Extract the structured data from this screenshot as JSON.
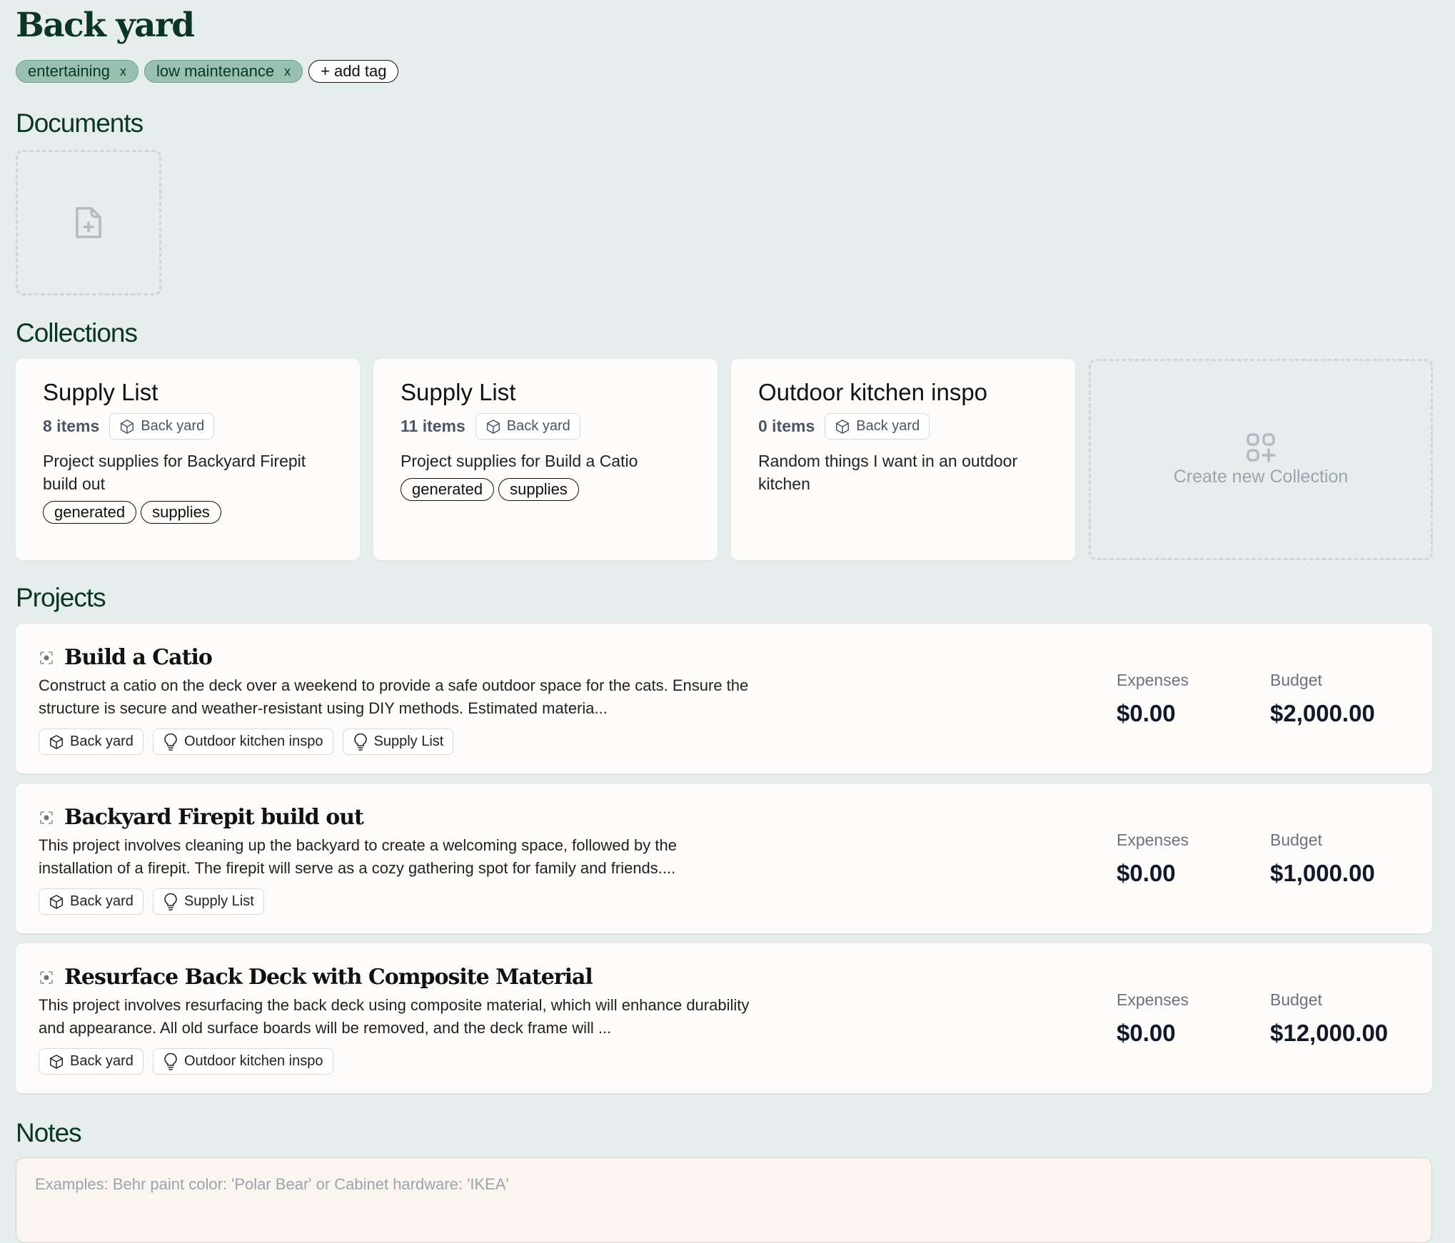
{
  "page": {
    "title": "Back yard",
    "tags": [
      {
        "label": "entertaining",
        "remove": "x"
      },
      {
        "label": "low maintenance",
        "remove": "x"
      }
    ],
    "add_tag_label": "+ add tag"
  },
  "sections": {
    "documents": "Documents",
    "collections": "Collections",
    "projects": "Projects",
    "notes": "Notes"
  },
  "documents": {
    "add_icon": "file-plus-icon"
  },
  "collections": [
    {
      "name": "Supply List",
      "count": "8 items",
      "space": "Back yard",
      "description": "Project supplies for Backyard Firepit build out",
      "tags": [
        "generated",
        "supplies"
      ]
    },
    {
      "name": "Supply List",
      "count": "11 items",
      "space": "Back yard",
      "description": "Project supplies for Build a Catio",
      "tags": [
        "generated",
        "supplies"
      ]
    },
    {
      "name": "Outdoor kitchen inspo",
      "count": "0 items",
      "space": "Back yard",
      "description": "Random things I want in an outdoor kitchen",
      "tags": []
    }
  ],
  "create_collection": {
    "label": "Create new Collection",
    "icon": "grid-plus-icon"
  },
  "projects": [
    {
      "name": "Build a Catio",
      "description": "Construct a catio on the deck over a weekend to provide a safe outdoor space for the cats. Ensure the structure is secure and weather-resistant using DIY methods. Estimated materia...",
      "chips": [
        {
          "icon": "cube-icon",
          "label": "Back yard"
        },
        {
          "icon": "lightbulb-icon",
          "label": "Outdoor kitchen inspo"
        },
        {
          "icon": "lightbulb-icon",
          "label": "Supply List"
        }
      ],
      "expenses_label": "Expenses",
      "expenses": "$0.00",
      "budget_label": "Budget",
      "budget": "$2,000.00"
    },
    {
      "name": "Backyard Firepit build out",
      "description": "This project involves cleaning up the backyard to create a welcoming space, followed by the installation of a firepit. The firepit will serve as a cozy gathering spot for family and friends....",
      "chips": [
        {
          "icon": "cube-icon",
          "label": "Back yard"
        },
        {
          "icon": "lightbulb-icon",
          "label": "Supply List"
        }
      ],
      "expenses_label": "Expenses",
      "expenses": "$0.00",
      "budget_label": "Budget",
      "budget": "$1,000.00"
    },
    {
      "name": "Resurface Back Deck with Composite Material",
      "description": "This project involves resurfacing the back deck using composite material, which will enhance durability and appearance. All old surface boards will be removed, and the deck frame will ...",
      "chips": [
        {
          "icon": "cube-icon",
          "label": "Back yard"
        },
        {
          "icon": "lightbulb-icon",
          "label": "Outdoor kitchen inspo"
        }
      ],
      "expenses_label": "Expenses",
      "expenses": "$0.00",
      "budget_label": "Budget",
      "budget": "$12,000.00"
    }
  ],
  "notes": {
    "placeholder": "Examples: Behr paint color: 'Polar Bear' or Cabinet hardware: 'IKEA'",
    "value": ""
  },
  "colors": {
    "background": "#e5eeed",
    "heading": "#0c3526",
    "tag_fill": "#99c1b2",
    "card": "#fdfcfa",
    "notes_bg": "#faf6ef"
  }
}
